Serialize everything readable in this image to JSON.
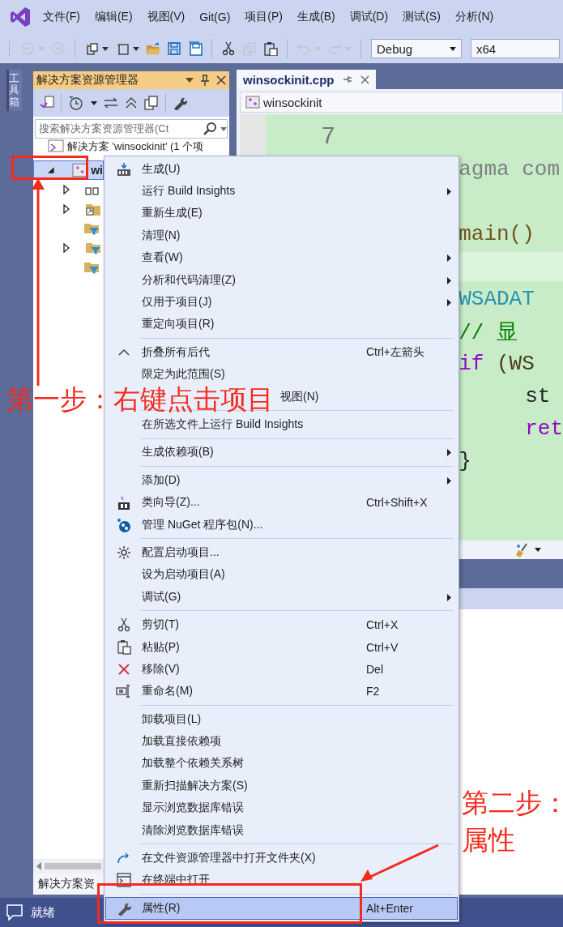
{
  "menubar": {
    "items": [
      "文件(F)",
      "编辑(E)",
      "视图(V)",
      "Git(G)",
      "项目(P)",
      "生成(B)",
      "调试(D)",
      "测试(S)",
      "分析(N)"
    ]
  },
  "toolbar": {
    "buttons": [
      {
        "kind": "back",
        "disabled": true
      },
      {
        "kind": "forward",
        "disabled": true
      },
      {
        "kind": "new-project",
        "disabled": false
      },
      {
        "kind": "add-item",
        "disabled": false
      },
      {
        "kind": "open",
        "disabled": false
      },
      {
        "kind": "save",
        "disabled": false
      },
      {
        "kind": "save-all",
        "disabled": false
      },
      {
        "kind": "cut",
        "disabled": false
      },
      {
        "kind": "copy",
        "disabled": true
      },
      {
        "kind": "paste",
        "disabled": false
      },
      {
        "kind": "undo",
        "disabled": true
      },
      {
        "kind": "redo",
        "disabled": true
      }
    ],
    "configuration": "Debug",
    "platform": "x64"
  },
  "toolbox": {
    "label": "工具箱"
  },
  "solution_explorer": {
    "title": "解决方案资源管理器",
    "search": {
      "placeholder": "搜索解决方案资源管理器(Ct"
    },
    "tree": [
      {
        "label": "解决方案 'winsockinit' (1 个项",
        "selected": false,
        "children": [
          {
            "label": "wi",
            "selected": true,
            "expanded": true,
            "children": [
              {
                "kind": "references",
                "expandable": true,
                "expanded": false
              },
              {
                "kind": "external",
                "expandable": true,
                "expanded": false
              },
              {
                "kind": "filter",
                "expandable": false,
                "expanded": false
              },
              {
                "kind": "filter",
                "expandable": true,
                "expanded": false
              },
              {
                "kind": "filter",
                "expandable": false,
                "expanded": false
              }
            ]
          }
        ]
      }
    ],
    "tab": "解决方案资"
  },
  "editor": {
    "tab": {
      "label": "winsockinit.cpp",
      "selected": true
    },
    "navigation": "winsockinit",
    "line_number": "7",
    "lines": [
      {
        "kind": "code",
        "indented": false,
        "tokens": [
          {
            "text": "agma com",
            "color": "#808080"
          }
        ]
      },
      {
        "kind": "blank"
      },
      {
        "kind": "code",
        "indented": false,
        "tokens": [
          {
            "text": "main()",
            "color": "#74531f"
          }
        ]
      },
      {
        "kind": "current"
      },
      {
        "kind": "code",
        "indented": false,
        "tokens": [
          {
            "text": "WSADAT",
            "color": "#2b91af"
          }
        ]
      },
      {
        "kind": "code",
        "indented": false,
        "tokens": [
          {
            "text": "// 显",
            "color": "#008000"
          }
        ]
      },
      {
        "kind": "code",
        "indented": false,
        "tokens": [
          {
            "text": "if",
            "color": "#8f08c4"
          },
          {
            "text": " (WS",
            "color": "#4a3a1a"
          }
        ]
      },
      {
        "kind": "code",
        "indented": true,
        "tokens": [
          {
            "text": "st",
            "color": "#1e1e1e"
          }
        ]
      },
      {
        "kind": "code",
        "indented": true,
        "tokens": [
          {
            "text": "ret",
            "color": "#8f08c4"
          }
        ]
      },
      {
        "kind": "code",
        "indented": false,
        "tokens": [
          {
            "text": "}",
            "color": "#1e1e1e"
          }
        ]
      }
    ]
  },
  "context_menu": {
    "items": [
      {
        "kind": "item",
        "label": "生成(U)",
        "submenu": false,
        "selected": false
      },
      {
        "kind": "item",
        "label": "运行 Build Insights",
        "submenu": true,
        "selected": false
      },
      {
        "kind": "item",
        "label": "重新生成(E)",
        "submenu": false,
        "selected": false
      },
      {
        "kind": "item",
        "label": "清理(N)",
        "submenu": false,
        "selected": false
      },
      {
        "kind": "item",
        "label": "查看(W)",
        "submenu": true,
        "selected": false
      },
      {
        "kind": "item",
        "label": "分析和代码清理(Z)",
        "submenu": true,
        "selected": false
      },
      {
        "kind": "item",
        "label": "仅用于项目(J)",
        "submenu": true,
        "selected": false
      },
      {
        "kind": "item",
        "label": "重定向项目(R)",
        "submenu": false,
        "selected": false
      },
      {
        "kind": "separator"
      },
      {
        "kind": "item",
        "label": "折叠所有后代",
        "shortcut": "Ctrl+左箭头",
        "submenu": false,
        "selected": false
      },
      {
        "kind": "item",
        "label": "限定为此范围(S)",
        "submenu": false,
        "selected": false
      },
      {
        "kind": "covered_item",
        "label": "视图(N)",
        "submenu": false,
        "selected": false
      },
      {
        "kind": "separator"
      },
      {
        "kind": "item",
        "label": "在所选文件上运行 Build Insights",
        "submenu": false,
        "selected": false
      },
      {
        "kind": "separator"
      },
      {
        "kind": "item",
        "label": "生成依赖项(B)",
        "submenu": true,
        "selected": false
      },
      {
        "kind": "separator"
      },
      {
        "kind": "item",
        "label": "添加(D)",
        "submenu": true,
        "selected": false
      },
      {
        "kind": "item",
        "label": "类向导(Z)...",
        "shortcut": "Ctrl+Shift+X",
        "submenu": false,
        "selected": false
      },
      {
        "kind": "item",
        "label": "管理 NuGet 程序包(N)...",
        "submenu": false,
        "selected": false
      },
      {
        "kind": "separator"
      },
      {
        "kind": "item",
        "label": "配置启动项目...",
        "submenu": false,
        "selected": false
      },
      {
        "kind": "item",
        "label": "设为启动项目(A)",
        "submenu": false,
        "selected": false
      },
      {
        "kind": "item",
        "label": "调试(G)",
        "submenu": true,
        "selected": false
      },
      {
        "kind": "separator"
      },
      {
        "kind": "item",
        "label": "剪切(T)",
        "shortcut": "Ctrl+X",
        "submenu": false,
        "selected": false
      },
      {
        "kind": "item",
        "label": "粘贴(P)",
        "shortcut": "Ctrl+V",
        "submenu": false,
        "selected": false
      },
      {
        "kind": "item",
        "label": "移除(V)",
        "shortcut": "Del",
        "submenu": false,
        "selected": false
      },
      {
        "kind": "item",
        "label": "重命名(M)",
        "shortcut": "F2",
        "submenu": false,
        "selected": false
      },
      {
        "kind": "separator"
      },
      {
        "kind": "item",
        "label": "卸载项目(L)",
        "submenu": false,
        "selected": false
      },
      {
        "kind": "item",
        "label": "加载直接依赖项",
        "submenu": false,
        "selected": false
      },
      {
        "kind": "item",
        "label": "加载整个依赖关系树",
        "submenu": false,
        "selected": false
      },
      {
        "kind": "item",
        "label": "重新扫描解决方案(S)",
        "submenu": false,
        "selected": false
      },
      {
        "kind": "item",
        "label": "显示浏览数据库错误",
        "submenu": false,
        "selected": false
      },
      {
        "kind": "item",
        "label": "清除浏览数据库错误",
        "submenu": false,
        "selected": false
      },
      {
        "kind": "separator"
      },
      {
        "kind": "item",
        "label": "在文件资源管理器中打开文件夹(X)",
        "submenu": false,
        "selected": false
      },
      {
        "kind": "item",
        "label": "在终端中打开",
        "submenu": false,
        "selected": false
      },
      {
        "kind": "separator"
      },
      {
        "kind": "item",
        "label": "属性(R)",
        "shortcut": "Alt+Enter",
        "submenu": false,
        "selected": true
      }
    ]
  },
  "status_bar": {
    "text": "就绪"
  },
  "annotations": {
    "step_one": "第一步：右键点击项目",
    "step_two": [
      "第二步：",
      "属性"
    ]
  }
}
